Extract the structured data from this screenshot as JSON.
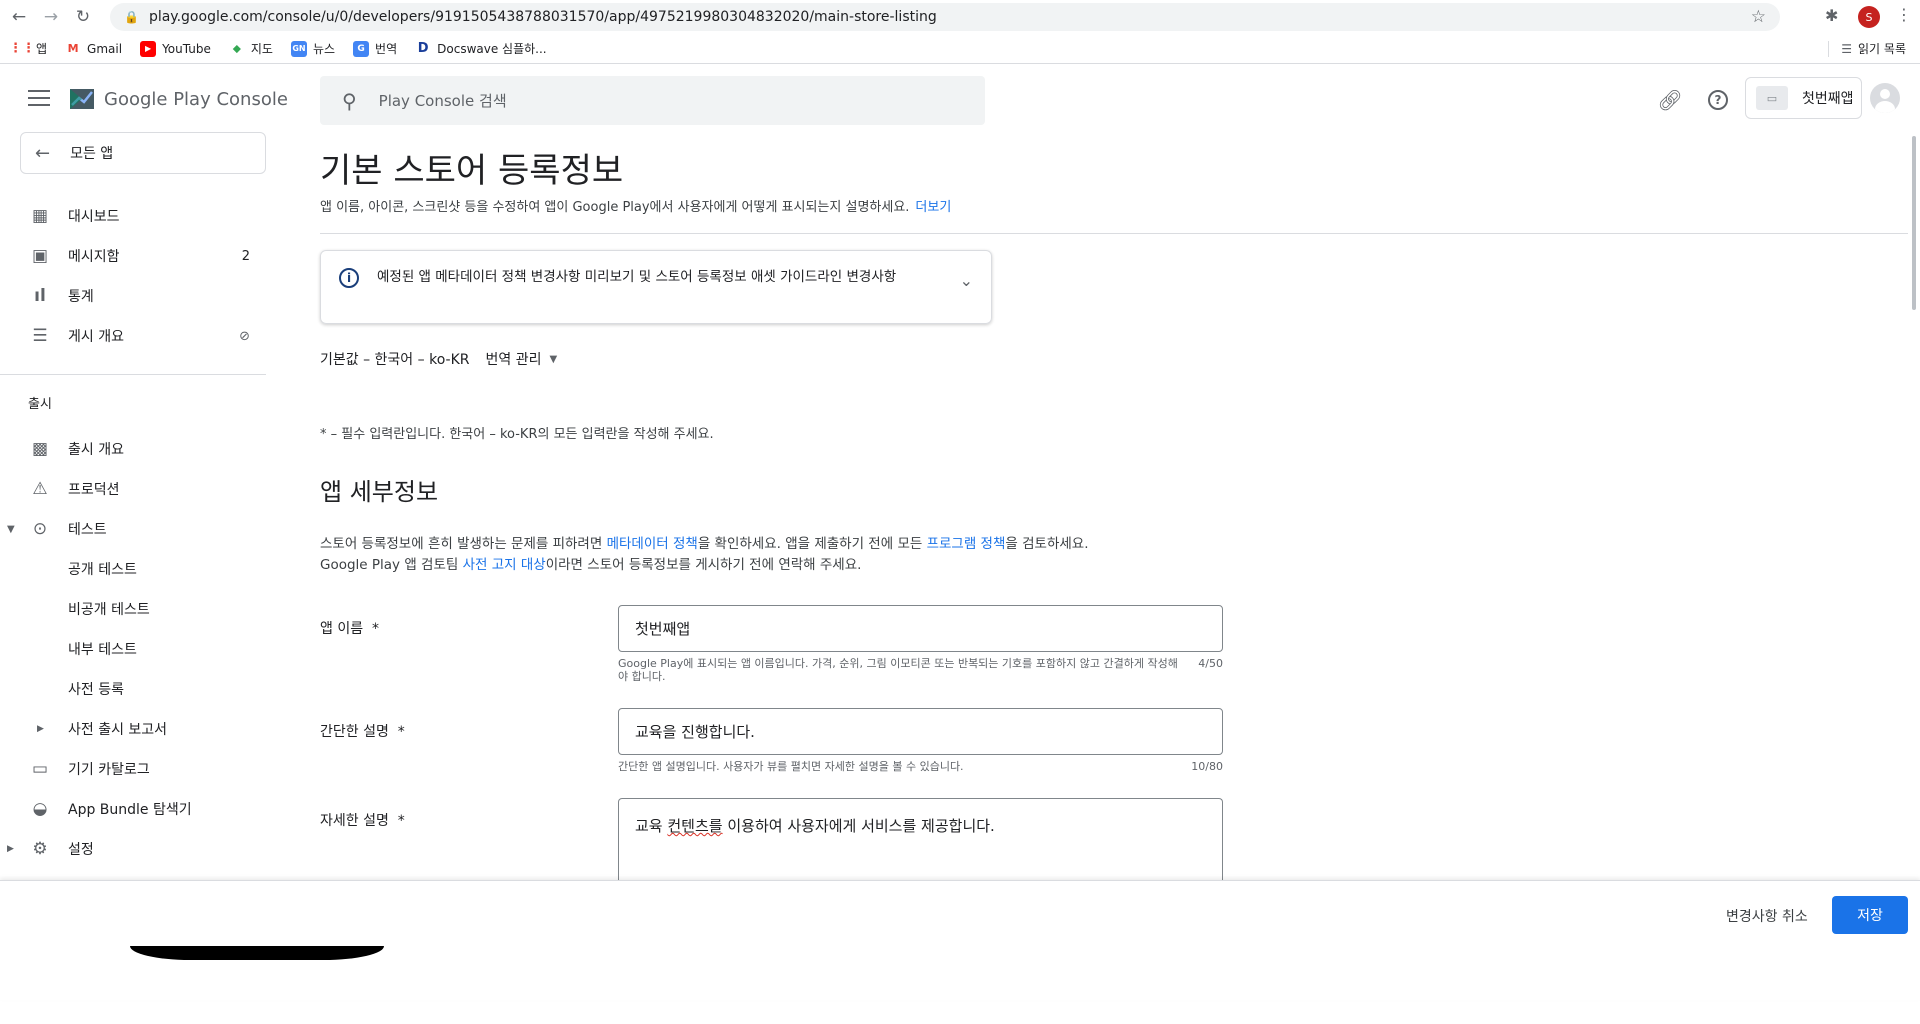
{
  "browser": {
    "url": "play.google.com/console/u/0/developers/9191505438788031570/app/4975219980304832020/main-store-listing",
    "profile_initial": "S",
    "bookmarks": [
      {
        "label": "앱",
        "icon": "apps-grid-icon"
      },
      {
        "label": "Gmail",
        "icon": "gmail-icon"
      },
      {
        "label": "YouTube",
        "icon": "youtube-icon"
      },
      {
        "label": "지도",
        "icon": "maps-icon"
      },
      {
        "label": "뉴스",
        "icon": "news-icon"
      },
      {
        "label": "번역",
        "icon": "translate-icon"
      },
      {
        "label": "Docswave 심플하...",
        "icon": "docswave-icon"
      }
    ],
    "reading_list": "읽기 목록"
  },
  "header": {
    "brand": "Google Play Console",
    "search_placeholder": "Play Console 검색",
    "app_name": "첫번째앱"
  },
  "sidebar": {
    "all_apps": "모든 앱",
    "top_items": [
      {
        "label": "대시보드",
        "icon": "dashboard-icon",
        "badge": ""
      },
      {
        "label": "메시지함",
        "icon": "inbox-icon",
        "badge": "2"
      },
      {
        "label": "통계",
        "icon": "bar-chart-icon",
        "badge": ""
      },
      {
        "label": "게시 개요",
        "icon": "publishing-overview-icon",
        "badge": ""
      }
    ],
    "release_section": "출시",
    "release_items": [
      {
        "label": "출시 개요",
        "icon": "release-overview-icon"
      },
      {
        "label": "프로덕션",
        "icon": "production-icon"
      },
      {
        "label": "테스트",
        "icon": "testing-icon"
      },
      {
        "label": "공개 테스트",
        "icon": ""
      },
      {
        "label": "비공개 테스트",
        "icon": ""
      },
      {
        "label": "내부 테스트",
        "icon": ""
      },
      {
        "label": "사전 등록",
        "icon": ""
      },
      {
        "label": "사전 출시 보고서",
        "icon": ""
      },
      {
        "label": "기기 카탈로그",
        "icon": "device-catalog-icon"
      },
      {
        "label": "App Bundle 탐색기",
        "icon": "app-bundle-icon"
      },
      {
        "label": "설정",
        "icon": "settings-gear-icon"
      }
    ]
  },
  "main": {
    "title": "기본 스토어 등록정보",
    "subtitle": "앱 이름, 아이콘, 스크린샷 등을 수정하여 앱이 Google Play에서 사용자에게 어떻게 표시되는지 설명하세요.",
    "learn_more": "더보기",
    "info_banner": "예정된 앱 메타데이터 정책 변경사항 미리보기 및 스토어 등록정보 애셋 가이드라인 변경사항",
    "default_language": "기본값 – 한국어 – ko-KR",
    "manage_translations": "번역 관리",
    "required_note": "* – 필수 입력란입니다. 한국어 – ko-KR의 모든 입력란을 작성해 주세요.",
    "section_title": "앱 세부정보",
    "policy_line1_a": "스토어 등록정보에 흔히 발생하는 문제를 피하려면 ",
    "policy_link1": "메타데이터 정책",
    "policy_line1_b": "을 확인하세요. 앱을 제출하기 전에 모든 ",
    "policy_link2": "프로그램 정책",
    "policy_line1_c": "을 검토하세요.",
    "policy_line2_a": "Google Play 앱 검토팀 ",
    "policy_link3": "사전 고지 대상",
    "policy_line2_b": "이라면 스토어 등록정보를 게시하기 전에 연락해 주세요.",
    "fields": {
      "app_name": {
        "label": "앱 이름",
        "required": "*",
        "value": "첫번째앱",
        "help": "Google Play에 표시되는 앱 이름입니다. 가격, 순위, 그림 이모티콘 또는 반복되는 기호를 포함하지 않고 간결하게 작성해야 합니다.",
        "count": "4/50"
      },
      "short_description": {
        "label": "간단한 설명",
        "required": "*",
        "value": "교육을 진행합니다.",
        "help": "간단한 앱 설명입니다. 사용자가 뷰를 펼치면 자세한 설명을 볼 수 있습니다.",
        "count": "10/80"
      },
      "full_description": {
        "label": "자세한 설명",
        "required": "*",
        "value_a": "교육 ",
        "value_misspelled": "컨텐츠를",
        "value_b": " 이용하여 사용자에게 서비스를 제공합니다."
      }
    }
  },
  "footer": {
    "discard": "변경사항 취소",
    "save": "저장"
  },
  "colors": {
    "accent": "#1a73e8",
    "text": "#202124",
    "muted": "#5f6368",
    "border": "#dadce0"
  }
}
